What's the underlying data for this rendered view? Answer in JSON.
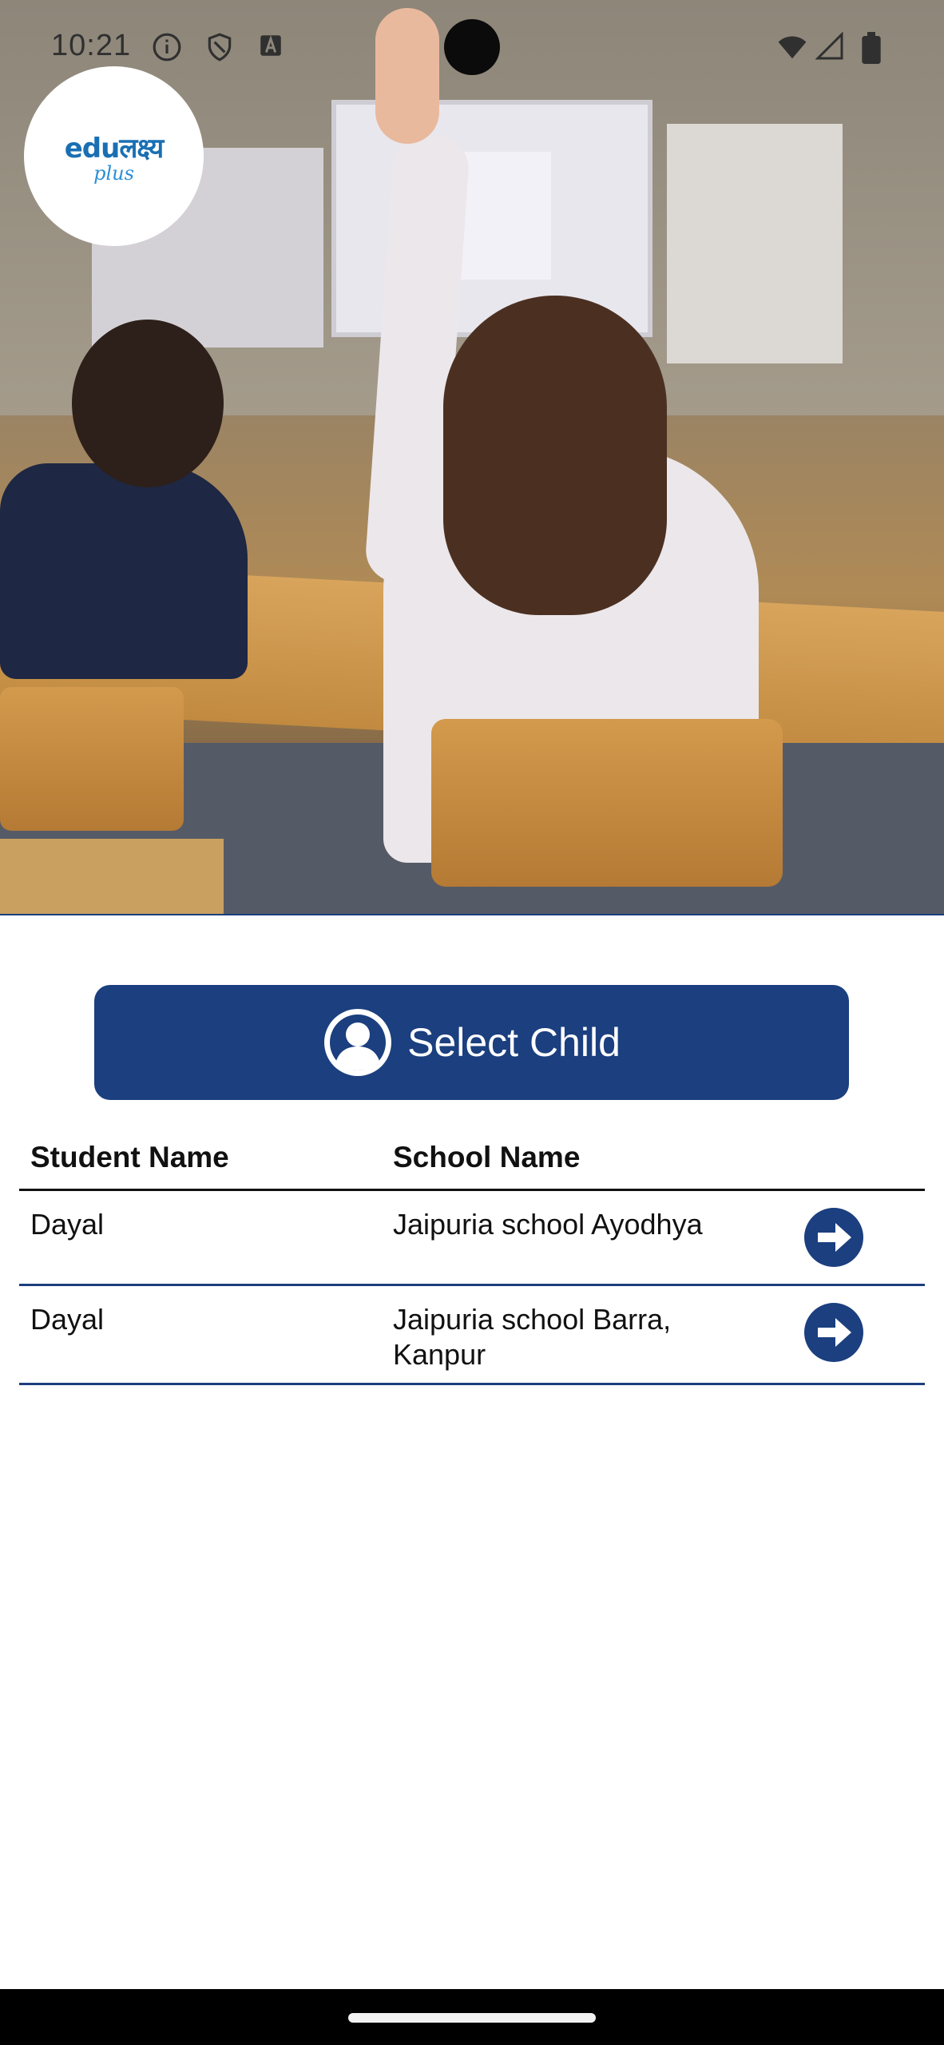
{
  "status_bar": {
    "time": "10:21"
  },
  "logo": {
    "main": "eduलक्ष्य",
    "sub": "plus"
  },
  "select_child_button": {
    "label": "Select Child"
  },
  "table": {
    "headers": [
      "Student Name",
      "School Name"
    ],
    "rows": [
      {
        "student": "Dayal",
        "school": "Jaipuria school Ayodhya"
      },
      {
        "student": "Dayal",
        "school": "Jaipuria school Barra, Kanpur"
      }
    ]
  },
  "colors": {
    "primary": "#1b3f7f",
    "divider": "#1c3f7d"
  }
}
